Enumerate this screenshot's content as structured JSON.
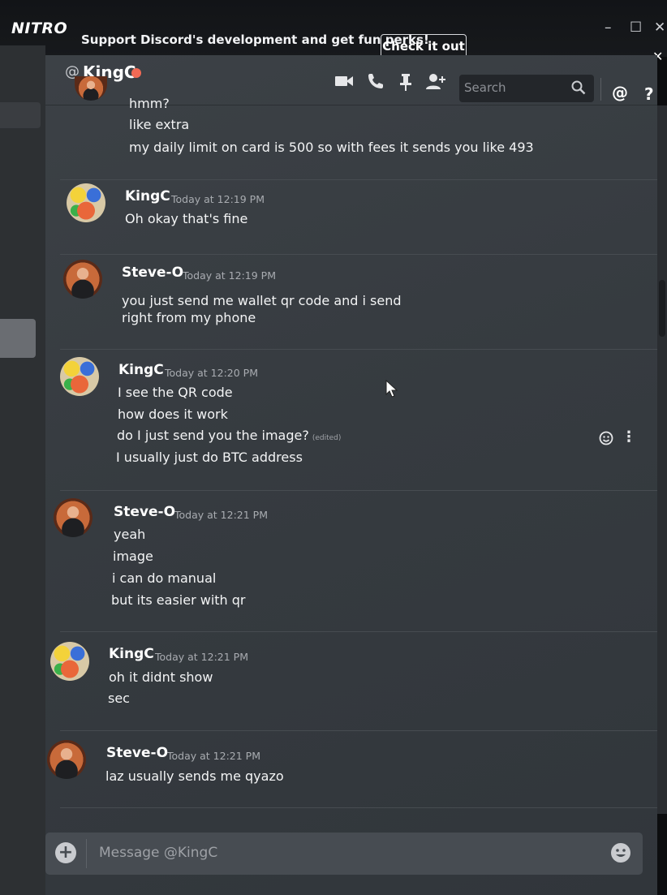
{
  "banner": {
    "logo": "NITRO",
    "text": "Support Discord's development and get fun perks!",
    "button": "Check it out",
    "close": "✕",
    "win_min": "–",
    "win_max": "☐",
    "win_close": "✕"
  },
  "header": {
    "at": "@",
    "name": "KingC",
    "search_placeholder": "Search",
    "mention": "@",
    "help": "?"
  },
  "messages": [
    {
      "author": "",
      "timestamp": "",
      "lines": [
        "hmm?",
        "like extra",
        "my daily limit on card is 500 so with fees it sends you like 493"
      ]
    },
    {
      "author": "KingC",
      "timestamp": "Today at 12:19 PM",
      "lines": [
        "Oh okay that's fine"
      ]
    },
    {
      "author": "Steve-O",
      "timestamp": "Today at 12:19 PM",
      "lines": [
        "you just send me wallet qr code and i send",
        "right from my phone"
      ]
    },
    {
      "author": "KingC",
      "timestamp": "Today at 12:20 PM",
      "lines": [
        "I see the QR code",
        "how does it work",
        "do I just send you the image?",
        "I usually just do BTC address"
      ],
      "edited": "(edited)"
    },
    {
      "author": "Steve-O",
      "timestamp": "Today at 12:21 PM",
      "lines": [
        "yeah",
        "image",
        "i can do manual",
        "but its easier with qr"
      ]
    },
    {
      "author": "KingC",
      "timestamp": "Today at 12:21 PM",
      "lines": [
        "oh it didnt show",
        "sec"
      ]
    },
    {
      "author": "Steve-O",
      "timestamp": "Today at 12:21 PM",
      "lines": [
        "laz usually sends me qyazo"
      ]
    }
  ],
  "composer": {
    "placeholder": "Message @KingC",
    "add": "+"
  },
  "colors": {
    "status_dnd": "#f26a55",
    "chat_bg": "#383d42",
    "banner_bg": "#17191c"
  },
  "icons": [
    "video-call-icon",
    "voice-call-icon",
    "pin-icon",
    "add-friend-icon",
    "search-icon",
    "mention-icon",
    "help-icon",
    "emoji-icon",
    "more-icon"
  ]
}
